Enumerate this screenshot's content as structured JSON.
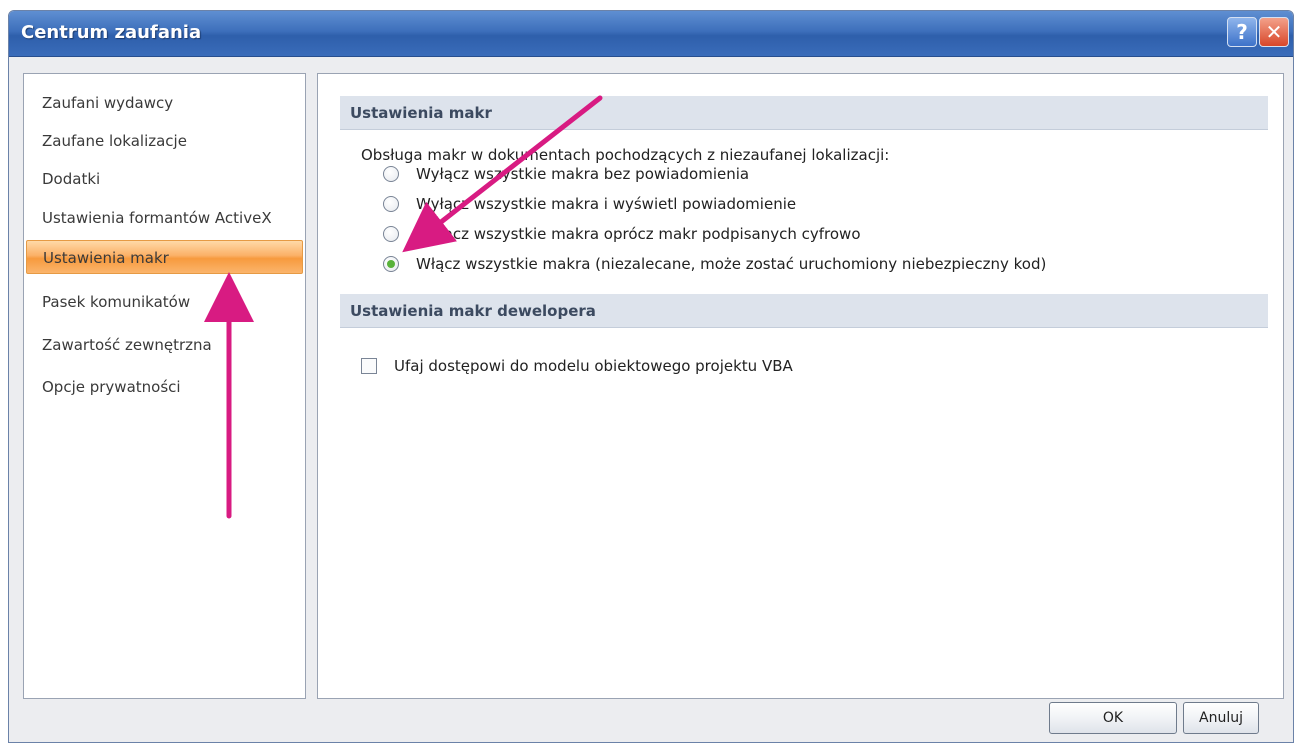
{
  "window": {
    "title": "Centrum zaufania",
    "help_label": "?",
    "close_label": "✕"
  },
  "sidebar": {
    "items": [
      {
        "label": "Zaufani wydawcy"
      },
      {
        "label": "Zaufane lokalizacje"
      },
      {
        "label": "Dodatki"
      },
      {
        "label": "Ustawienia formantów ActiveX"
      },
      {
        "label": "Ustawienia makr",
        "selected": true
      },
      {
        "label": "Pasek komunikatów"
      },
      {
        "label": "Zawartość zewnętrzna"
      },
      {
        "label": "Opcje prywatności"
      }
    ]
  },
  "macro_settings": {
    "header": "Ustawienia makr",
    "intro": "Obsługa makr w dokumentach pochodzących z niezaufanej lokalizacji:",
    "options": [
      {
        "label": "Wyłącz wszystkie makra bez powiadomienia",
        "checked": false
      },
      {
        "label": "Wyłącz wszystkie makra i wyświetl powiadomienie",
        "checked": false
      },
      {
        "label": "Wyłącz wszystkie makra oprócz makr podpisanych cyfrowo",
        "checked": false
      },
      {
        "label": "Włącz wszystkie makra (niezalecane, może zostać uruchomiony niebezpieczny kod)",
        "checked": true
      }
    ]
  },
  "developer_settings": {
    "header": "Ustawienia makr dewelopera",
    "vba_trust_label": "Ufaj dostępowi do modelu obiektowego projektu VBA",
    "vba_trust_checked": false
  },
  "footer": {
    "ok_label": "OK",
    "cancel_label": "Anuluj"
  },
  "colors": {
    "title_bar": "#3d6fbb",
    "selected_item": "#f79a3e",
    "annotation_arrow": "#d81b82",
    "radio_checked": "#58b23a"
  }
}
